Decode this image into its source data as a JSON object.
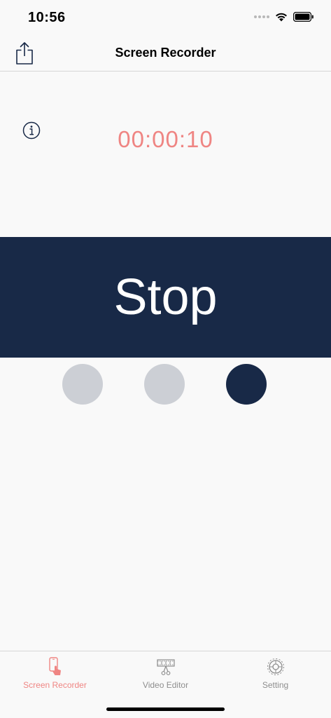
{
  "status_bar": {
    "time": "10:56"
  },
  "nav": {
    "title": "Screen Recorder",
    "share_icon": "share-icon"
  },
  "recorder": {
    "timer": "00:00:10",
    "stop_label": "Stop",
    "info_icon": "info-icon",
    "page_dots": {
      "count": 3,
      "selected": 3
    }
  },
  "tabs": [
    {
      "label": "Screen Recorder",
      "icon": "phone-tap-icon",
      "active": true
    },
    {
      "label": "Video Editor",
      "icon": "film-scissors-icon",
      "active": false
    },
    {
      "label": "Setting",
      "icon": "gear-icon",
      "active": false
    }
  ],
  "colors": {
    "accent": "#ef8583",
    "navy": "#182947",
    "dot_inactive": "#cccfd5",
    "tab_inactive": "#8e8e8e"
  }
}
